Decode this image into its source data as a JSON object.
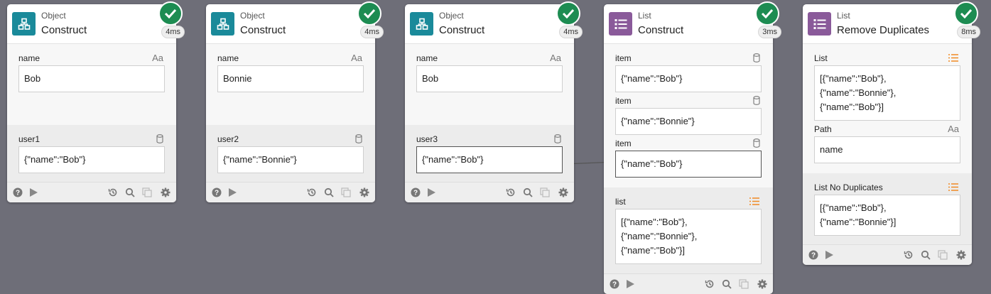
{
  "nodes": [
    {
      "category": "Object",
      "title": "Construct",
      "time": "4ms",
      "icon": "object-icon",
      "icon_color": "#1a8a9a",
      "inputs": [
        {
          "label": "name",
          "value": "Bob",
          "type": "text-icon"
        }
      ],
      "outputs": [
        {
          "label": "user1",
          "value": "{\"name\":\"Bob\"}",
          "type": "database-icon"
        }
      ]
    },
    {
      "category": "Object",
      "title": "Construct",
      "time": "4ms",
      "icon": "object-icon",
      "icon_color": "#1a8a9a",
      "inputs": [
        {
          "label": "name",
          "value": "Bonnie",
          "type": "text-icon"
        }
      ],
      "outputs": [
        {
          "label": "user2",
          "value": "{\"name\":\"Bonnie\"}",
          "type": "database-icon"
        }
      ]
    },
    {
      "category": "Object",
      "title": "Construct",
      "time": "4ms",
      "icon": "object-icon",
      "icon_color": "#1a8a9a",
      "inputs": [
        {
          "label": "name",
          "value": "Bob",
          "type": "text-icon"
        }
      ],
      "outputs": [
        {
          "label": "user3",
          "value": "{\"name\":\"Bob\"}",
          "type": "database-icon"
        }
      ]
    },
    {
      "category": "List",
      "title": "Construct",
      "time": "3ms",
      "icon": "list-icon",
      "icon_color": "#8a5a9a",
      "inputs": [
        {
          "label": "item",
          "value": "{\"name\":\"Bob\"}",
          "type": "database-icon"
        },
        {
          "label": "item",
          "value": "{\"name\":\"Bonnie\"}",
          "type": "database-icon"
        },
        {
          "label": "item",
          "value": "{\"name\":\"Bob\"}",
          "type": "database-icon"
        }
      ],
      "outputs": [
        {
          "label": "list",
          "value": "[{\"name\":\"Bob\"},\n{\"name\":\"Bonnie\"},\n{\"name\":\"Bob\"}]",
          "type": "list-type-icon"
        }
      ]
    },
    {
      "category": "List",
      "title": "Remove Duplicates",
      "time": "8ms",
      "icon": "list-icon",
      "icon_color": "#8a5a9a",
      "inputs": [
        {
          "label": "List",
          "value": "[{\"name\":\"Bob\"},\n{\"name\":\"Bonnie\"},\n{\"name\":\"Bob\"}]",
          "type": "list-type-icon"
        },
        {
          "label": "Path",
          "value": "name",
          "type": "text-icon"
        }
      ],
      "outputs": [
        {
          "label": "List No Duplicates",
          "value": "[{\"name\":\"Bob\"},\n{\"name\":\"Bonnie\"}]",
          "type": "list-type-icon"
        }
      ]
    }
  ],
  "type_glyphs": {
    "text-icon": "Aa"
  },
  "colors": {
    "canvas": "#6e6e78",
    "success": "#1d8c52",
    "list_type": "#f08a24"
  }
}
